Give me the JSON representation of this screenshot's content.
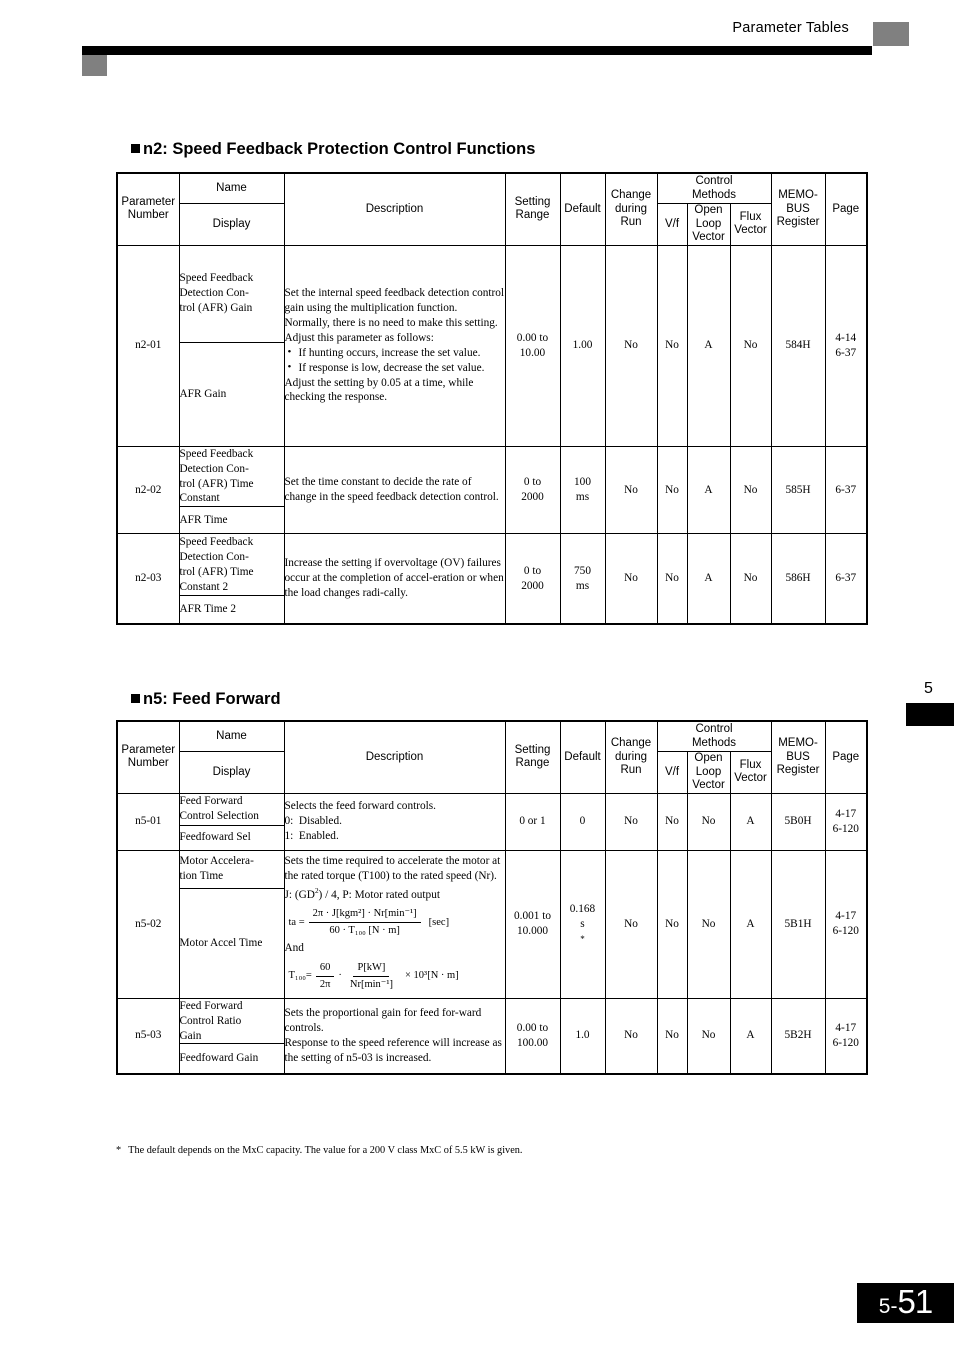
{
  "header": {
    "title": "Parameter Tables"
  },
  "chapter": {
    "number": "5"
  },
  "page_number": {
    "prefix": "5-",
    "value": "51"
  },
  "table_header": {
    "parameter_number": "Parameter\nNumber",
    "parameter_number_l1": "Parameter",
    "parameter_number_l2": "Number",
    "name": "Name",
    "display": "Display",
    "description": "Description",
    "setting_range_l1": "Setting",
    "setting_range_l2": "Range",
    "default": "Default",
    "change_during_run_l1": "Change",
    "change_during_run_l2": "during",
    "change_during_run_l3": "Run",
    "control_methods_l1": "Control",
    "control_methods_l2": "Methods",
    "vf": "V/f",
    "open_loop_vector_l1": "Open",
    "open_loop_vector_l2": "Loop",
    "open_loop_vector_l3": "Vector",
    "flux_vector_l1": "Flux",
    "flux_vector_l2": "Vector",
    "memobus_l1": "MEMO-",
    "memobus_l2": "BUS",
    "memobus_l3": "Register",
    "page": "Page"
  },
  "sections": [
    {
      "heading": "n2: Speed Feedback Protection Control Functions",
      "rows": [
        {
          "parameter_number": "n2-01",
          "name": "Speed Feedback Detection Con-trol (AFR) Gain",
          "name_l1": "Speed Feedback",
          "name_l2": "Detection Con-",
          "name_l3": "trol (AFR) Gain",
          "display": "AFR Gain",
          "desc_p1": "Set the internal speed feedback detection control gain using the multiplication function.",
          "desc_p2": "Normally, there is no need to make this setting.",
          "desc_p3": "Adjust this parameter as follows:",
          "desc_b1": "If hunting occurs, increase the set value.",
          "desc_b2": "If response is low, decrease the set value.",
          "desc_p4": "Adjust the setting by 0.05 at a time, while checking the response.",
          "setting_range_l1": "0.00 to",
          "setting_range_l2": "10.00",
          "default": "1.00",
          "change_during_run": "No",
          "vf": "No",
          "open_loop_vector": "A",
          "flux_vector": "No",
          "memobus": "584H",
          "page_l1": "4-14",
          "page_l2": "6-37"
        },
        {
          "parameter_number": "n2-02",
          "name_l1": "Speed Feedback",
          "name_l2": "Detection Con-",
          "name_l3": "trol (AFR) Time",
          "name_l4": "Constant",
          "display": "AFR Time",
          "desc_p1": "Set the time constant to decide the rate of change in the speed feedback detection control.",
          "setting_range_l1": "0 to",
          "setting_range_l2": "2000",
          "default_l1": "100",
          "default_l2": "ms",
          "change_during_run": "No",
          "vf": "No",
          "open_loop_vector": "A",
          "flux_vector": "No",
          "memobus": "585H",
          "page_l1": "6-37"
        },
        {
          "parameter_number": "n2-03",
          "name_l1": "Speed Feedback",
          "name_l2": "Detection Con-",
          "name_l3": "trol (AFR) Time",
          "name_l4": "Constant 2",
          "display": "AFR Time 2",
          "desc_p1": "Increase the setting if overvoltage (OV) failures occur at the completion of accel-eration or when the load changes radi-cally.",
          "setting_range_l1": "0 to",
          "setting_range_l2": "2000",
          "default_l1": "750",
          "default_l2": "ms",
          "change_during_run": "No",
          "vf": "No",
          "open_loop_vector": "A",
          "flux_vector": "No",
          "memobus": "586H",
          "page_l1": "6-37"
        }
      ]
    },
    {
      "heading": "n5: Feed Forward",
      "rows": [
        {
          "parameter_number": "n5-01",
          "name_l1": "Feed Forward",
          "name_l2": "Control Selection",
          "display": "Feedfoward Sel",
          "desc_p1": "Selects the feed forward controls.",
          "desc_opt1": "0:  Disabled.",
          "desc_opt2": "1:  Enabled.",
          "setting_range_l1": "0 or 1",
          "default": "0",
          "change_during_run": "No",
          "vf": "No",
          "open_loop_vector": "No",
          "flux_vector": "A",
          "memobus": "5B0H",
          "page_l1": "4-17",
          "page_l2": "6-120"
        },
        {
          "parameter_number": "n5-02",
          "name_l1": "Motor Accelera-",
          "name_l2": "tion Time",
          "display": "Motor Accel Time",
          "desc_p1": "Sets the time required to accelerate the motor at the rated torque (T100) to the rated speed (Nr).",
          "desc_p2_pre": "J: (GD",
          "desc_p2_sup": "2",
          "desc_p2_post": ") / 4, P: Motor rated output",
          "formula1": {
            "lhs": "ta =",
            "numerator": "2π · J[kgm²] · Nr[min⁻¹]",
            "denominator": "60 · T₁₀₀ [N · m]",
            "rhs": "[sec]"
          },
          "desc_and": "And",
          "formula2": {
            "lhs": "T₁₀₀=",
            "frac1_num": "60",
            "frac1_den": "2π",
            "dot": "·",
            "frac2_num": "P[kW]",
            "frac2_den": "Nr[min⁻¹]",
            "rhs": "× 10³[N · m]"
          },
          "setting_range_l1": "0.001 to",
          "setting_range_l2": "10.000",
          "default_l1": "0.168",
          "default_l2": "s",
          "default_l3": "*",
          "change_during_run": "No",
          "vf": "No",
          "open_loop_vector": "No",
          "flux_vector": "A",
          "memobus": "5B1H",
          "page_l1": "4-17",
          "page_l2": "6-120"
        },
        {
          "parameter_number": "n5-03",
          "name_l1": "Feed Forward",
          "name_l2": "Control Ratio",
          "name_l3": "Gain",
          "display": "Feedfoward Gain",
          "desc_p1": "Sets the proportional gain for feed for-ward controls.",
          "desc_p2": "Response to the speed reference will increase as the setting of n5-03 is increased.",
          "setting_range_l1": "0.00 to",
          "setting_range_l2": "100.00",
          "default": "1.0",
          "change_during_run": "No",
          "vf": "No",
          "open_loop_vector": "No",
          "flux_vector": "A",
          "memobus": "5B2H",
          "page_l1": "4-17",
          "page_l2": "6-120"
        }
      ]
    }
  ],
  "footnote": {
    "marker": "*",
    "text": "The default depends on the MxC capacity. The value for a 200 V class MxC of 5.5 kW is given."
  }
}
